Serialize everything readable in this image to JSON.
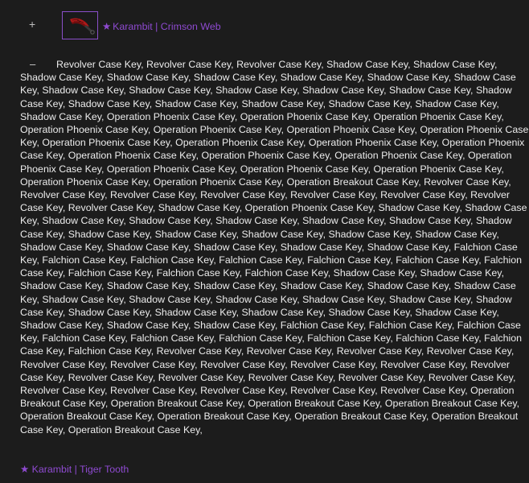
{
  "trade": {
    "expand_glyph": "+",
    "collapse_glyph": "–",
    "item": {
      "star": "★",
      "name": "Karambit | Crimson Web",
      "icon": "karambit-knife-icon"
    },
    "keys": [
      "Revolver Case Key",
      "Revolver Case Key",
      "Revolver Case Key",
      "Shadow Case Key",
      "Shadow Case Key",
      "Shadow Case Key",
      "Shadow Case Key",
      "Shadow Case Key",
      "Shadow Case Key",
      "Shadow Case Key",
      "Shadow Case Key",
      "Shadow Case Key",
      "Shadow Case Key",
      "Shadow Case Key",
      "Shadow Case Key",
      "Shadow Case Key",
      "Shadow Case Key",
      "Shadow Case Key",
      "Shadow Case Key",
      "Shadow Case Key",
      "Shadow Case Key",
      "Shadow Case Key",
      "Shadow Case Key",
      "Operation Phoenix Case Key",
      "Operation Phoenix Case Key",
      "Operation Phoenix Case Key",
      "Operation Phoenix Case Key",
      "Operation Phoenix Case Key",
      "Operation Phoenix Case Key",
      "Operation Phoenix Case Key",
      "Operation Phoenix Case Key",
      "Operation Phoenix Case Key",
      "Operation Phoenix Case Key",
      "Operation Phoenix Case Key",
      "Operation Phoenix Case Key",
      "Operation Phoenix Case Key",
      "Operation Phoenix Case Key",
      "Operation Phoenix Case Key",
      "Operation Phoenix Case Key",
      "Operation Phoenix Case Key",
      "Operation Phoenix Case Key",
      "Operation Phoenix Case Key",
      "Operation Phoenix Case Key",
      "Operation Breakout Case Key",
      "Revolver Case Key",
      "Revolver Case Key",
      "Revolver Case Key",
      "Revolver Case Key",
      "Revolver Case Key",
      "Revolver Case Key",
      "Revolver Case Key",
      "Revolver Case Key",
      "Shadow Case Key",
      "Operation Phoenix Case Key",
      "Shadow Case Key",
      "Shadow Case Key",
      "Shadow Case Key",
      "Shadow Case Key",
      "Shadow Case Key",
      "Shadow Case Key",
      "Shadow Case Key",
      "Shadow Case Key",
      "Shadow Case Key",
      "Shadow Case Key",
      "Shadow Case Key",
      "Shadow Case Key",
      "Shadow Case Key",
      "Shadow Case Key",
      "Shadow Case Key",
      "Shadow Case Key",
      "Shadow Case Key",
      "Shadow Case Key",
      "Falchion Case Key",
      "Falchion Case Key",
      "Falchion Case Key",
      "Falchion Case Key",
      "Falchion Case Key",
      "Falchion Case Key",
      "Falchion Case Key",
      "Falchion Case Key",
      "Falchion Case Key",
      "Falchion Case Key",
      "Shadow Case Key",
      "Shadow Case Key",
      "Shadow Case Key",
      "Shadow Case Key",
      "Shadow Case Key",
      "Shadow Case Key",
      "Shadow Case Key",
      "Shadow Case Key",
      "Shadow Case Key",
      "Shadow Case Key",
      "Shadow Case Key",
      "Shadow Case Key",
      "Shadow Case Key",
      "Shadow Case Key",
      "Shadow Case Key",
      "Shadow Case Key",
      "Shadow Case Key",
      "Shadow Case Key",
      "Shadow Case Key",
      "Shadow Case Key",
      "Shadow Case Key",
      "Shadow Case Key",
      "Falchion Case Key",
      "Falchion Case Key",
      "Falchion Case Key",
      "Falchion Case Key",
      "Falchion Case Key",
      "Falchion Case Key",
      "Falchion Case Key",
      "Falchion Case Key",
      "Falchion Case Key",
      "Falchion Case Key",
      "Revolver Case Key",
      "Revolver Case Key",
      "Revolver Case Key",
      "Revolver Case Key",
      "Revolver Case Key",
      "Revolver Case Key",
      "Revolver Case Key",
      "Revolver Case Key",
      "Revolver Case Key",
      "Revolver Case Key",
      "Revolver Case Key",
      "Revolver Case Key",
      "Revolver Case Key",
      "Revolver Case Key",
      "Revolver Case Key",
      "Revolver Case Key",
      "Revolver Case Key",
      "Revolver Case Key",
      "Revolver Case Key",
      "Revolver Case Key",
      "Operation Breakout Case Key",
      "Operation Breakout Case Key",
      "Operation Breakout Case Key",
      "Operation Breakout Case Key",
      "Operation Breakout Case Key",
      "Operation Breakout Case Key",
      "Operation Breakout Case Key",
      "Operation Breakout Case Key",
      "Operation Breakout Case Key"
    ],
    "separator": ", ",
    "terminator": ","
  },
  "next_item": {
    "star": "★",
    "name": "Karambit | Tiger Tooth"
  },
  "colors": {
    "background": "#1c1c1c",
    "text": "#ececec",
    "item_link": "#8e4ad0",
    "thumb_border": "#8a4fc9"
  }
}
